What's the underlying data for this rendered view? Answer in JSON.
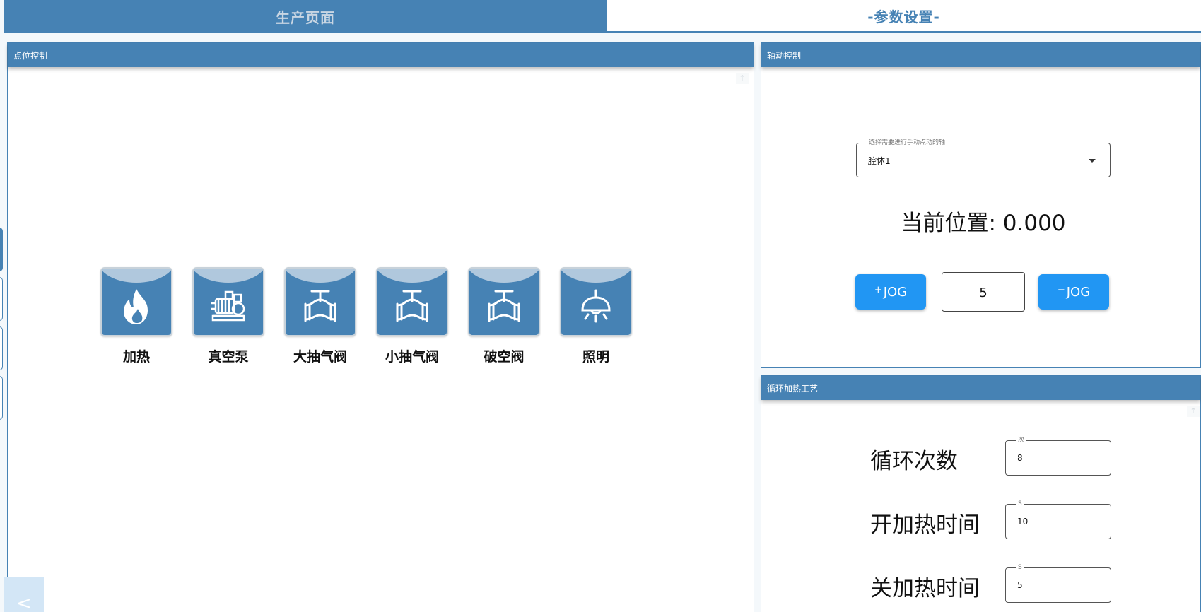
{
  "tabs": [
    {
      "label": "生产页面"
    },
    {
      "label": "-参数设置-"
    }
  ],
  "point_control": {
    "title": "点位控制",
    "devices": [
      {
        "label": "加热",
        "icon": "flame-icon"
      },
      {
        "label": "真空泵",
        "icon": "vacuum-pump-icon"
      },
      {
        "label": "大抽气阀",
        "icon": "valve-icon"
      },
      {
        "label": "小抽气阀",
        "icon": "valve-icon"
      },
      {
        "label": "破空阀",
        "icon": "valve-icon"
      },
      {
        "label": "照明",
        "icon": "lamp-icon"
      }
    ]
  },
  "axis_control": {
    "title": "轴动控制",
    "select_label": "选择需要进行手动点动的轴",
    "select_value": "腔体1",
    "position_label": "当前位置: 0.000",
    "jog_plus": {
      "sign": "+",
      "label": "JOG"
    },
    "jog_minus": {
      "sign": "−",
      "label": "JOG"
    },
    "jog_step": "5"
  },
  "cycle_heating": {
    "title": "循环加热工艺",
    "rows": [
      {
        "label": "循环次数",
        "unit": "次",
        "value": "8"
      },
      {
        "label": "开加热时间",
        "unit": "S",
        "value": "10"
      },
      {
        "label": "关加热时间",
        "unit": "S",
        "value": "5"
      }
    ]
  },
  "collapse_label": "<",
  "colors": {
    "primary": "#4682b4",
    "cap": "#b0c8dd",
    "jog": "#2196f3"
  }
}
